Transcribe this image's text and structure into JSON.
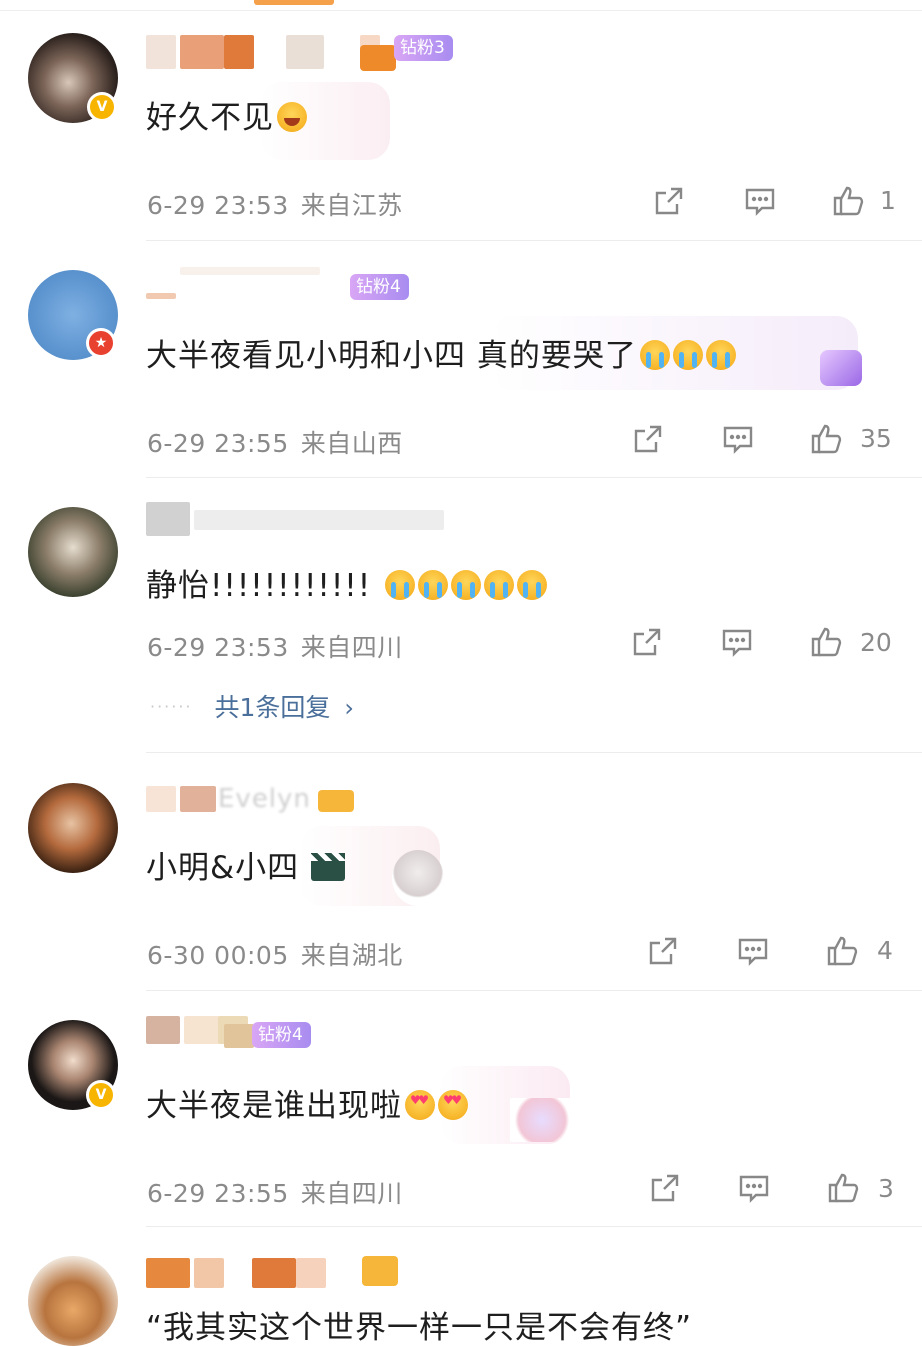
{
  "fan_tags": {
    "c1": "钻粉3",
    "c2": "钻粉4",
    "c5": "钻粉4"
  },
  "comments": [
    {
      "text": "好久不见",
      "time": "6-29 23:53",
      "location": "来自江苏",
      "likes": "1"
    },
    {
      "text": "大半夜看见小明和小四 真的要哭了",
      "time": "6-29 23:55",
      "location": "来自山西",
      "likes": "35"
    },
    {
      "text": "静怡!!!!!!!!!!!!",
      "time": "6-29 23:53",
      "location": "来自四川",
      "likes": "20",
      "replies": "共1条回复"
    },
    {
      "text": "小明&小四",
      "name_partial": "Evelyn",
      "time": "6-30 00:05",
      "location": "来自湖北",
      "likes": "4"
    },
    {
      "text": "大半夜是谁出现啦",
      "time": "6-29 23:55",
      "location": "来自四川",
      "likes": "3"
    },
    {
      "text": "“我其实这个世界一样一只是不会有终”"
    }
  ],
  "colors": {
    "reply_link": "#4a6f9a",
    "meta_gray": "#8a8a8a",
    "vip_gold": "#f7b500",
    "tag_purple": "#b89af2",
    "tab_indicator": "#f5a04a"
  },
  "icons": [
    "forward-icon",
    "comment-icon",
    "thumbs-up-icon",
    "chevron-right-icon",
    "verified-v-badge",
    "red-star-badge"
  ]
}
